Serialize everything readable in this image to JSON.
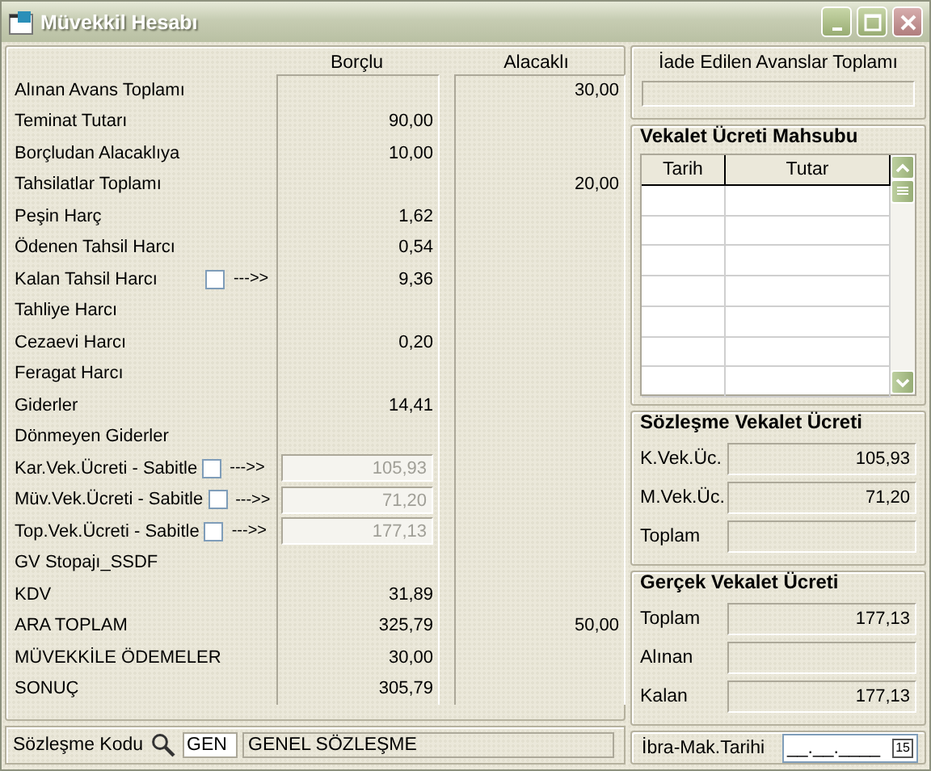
{
  "window": {
    "title": "Müvekkil Hesabı"
  },
  "ledger": {
    "columns": [
      "Borçlu",
      "Alacaklı"
    ],
    "rows": [
      {
        "label": "Alınan Avans Toplamı",
        "kind": "plain",
        "alacakli": "30,00"
      },
      {
        "label": "Teminat Tutarı",
        "kind": "plain",
        "borclu": "90,00"
      },
      {
        "label": "Borçludan Alacaklıya",
        "kind": "plain",
        "borclu": "10,00"
      },
      {
        "label": "Tahsilatlar Toplamı",
        "kind": "plain",
        "alacakli": "20,00"
      },
      {
        "label": "Peşin Harç",
        "kind": "plain",
        "borclu": "1,62"
      },
      {
        "label": "Ödenen Tahsil Harcı",
        "kind": "plain",
        "borclu": "0,54"
      },
      {
        "label": "Kalan Tahsil Harcı",
        "kind": "check",
        "checked": false,
        "arrow": "--->>",
        "borclu": "9,36"
      },
      {
        "label": "Tahliye Harcı",
        "kind": "plain"
      },
      {
        "label": "Cezaevi Harcı",
        "kind": "plain",
        "borclu": "0,20"
      },
      {
        "label": "Feragat Harcı",
        "kind": "plain"
      },
      {
        "label": "Giderler",
        "kind": "plain",
        "borclu": "14,41"
      },
      {
        "label": "Dönmeyen Giderler",
        "kind": "plain"
      },
      {
        "label": "Kar.Vek.Ücreti - Sabitle",
        "kind": "fixed",
        "checked": false,
        "arrow": "--->>",
        "borclu": "105,93"
      },
      {
        "label": "Müv.Vek.Ücreti - Sabitle",
        "kind": "fixed",
        "checked": false,
        "arrow": "--->>",
        "borclu": "71,20"
      },
      {
        "label": "Top.Vek.Ücreti - Sabitle",
        "kind": "fixed",
        "checked": false,
        "arrow": "--->>",
        "borclu": "177,13"
      },
      {
        "label": "GV Stopajı_SSDF",
        "kind": "plain"
      },
      {
        "label": "KDV",
        "kind": "plain",
        "borclu": "31,89"
      },
      {
        "label": "ARA TOPLAM",
        "kind": "plain",
        "borclu": "325,79",
        "alacakli": "50,00"
      },
      {
        "label": "MÜVEKKİLE ÖDEMELER",
        "kind": "plain",
        "borclu": "30,00"
      },
      {
        "label": "SONUÇ",
        "kind": "plain",
        "borclu": "305,79"
      }
    ]
  },
  "contract": {
    "label": "Sözleşme Kodu",
    "code": "GEN",
    "name": "GENEL SÖZLEŞME"
  },
  "refunds": {
    "title": "İade Edilen Avanslar Toplamı"
  },
  "fee_offset": {
    "title": "Vekalet Ücreti Mahsubu",
    "columns": [
      "Tarih",
      "Tutar"
    ]
  },
  "contract_fee": {
    "title": "Sözleşme Vekalet Ücreti",
    "fields": [
      {
        "label": "K.Vek.Üc.",
        "value": "105,93"
      },
      {
        "label": "M.Vek.Üc.",
        "value": "71,20"
      },
      {
        "label": "Toplam"
      }
    ]
  },
  "actual_fee": {
    "title": "Gerçek Vekalet Ücreti",
    "fields": [
      {
        "label": "Toplam",
        "value": "177,13"
      },
      {
        "label": "Alınan"
      },
      {
        "label": "Kalan",
        "value": "177,13"
      }
    ]
  },
  "release_date": {
    "label": "İbra-Mak.Tarihi",
    "placeholder": "__.__.____",
    "calendar": "15"
  }
}
